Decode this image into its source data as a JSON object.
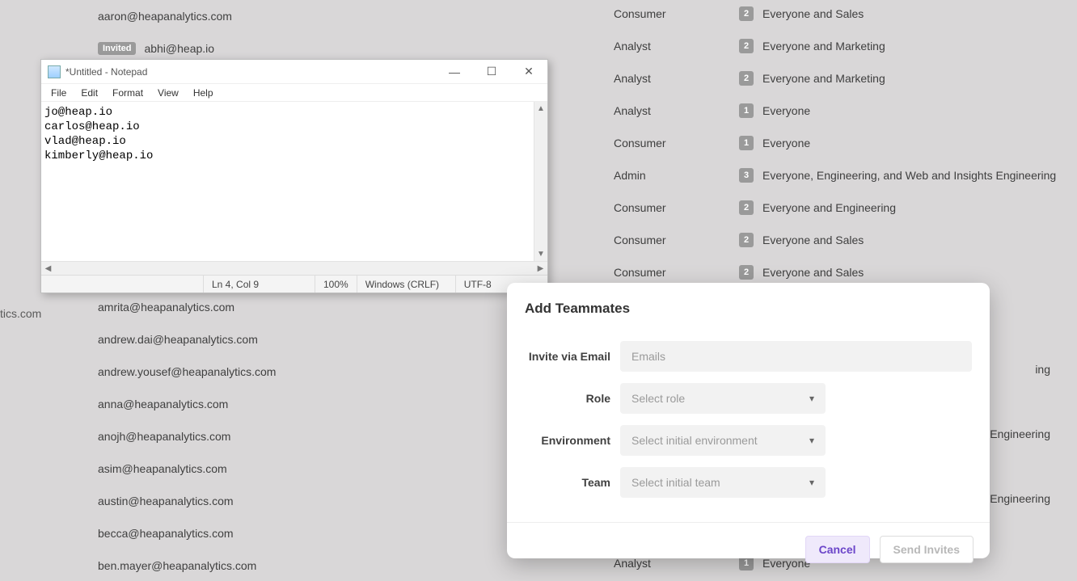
{
  "bg": {
    "left_partial_label": "tics.com",
    "emails": [
      {
        "email": "aaron@heapanalytics.com",
        "invited": false
      },
      {
        "email": "abhi@heap.io",
        "invited": true
      },
      {
        "email": "",
        "invited": false
      },
      {
        "email": "",
        "invited": false
      },
      {
        "email": "",
        "invited": false
      },
      {
        "email": "",
        "invited": false
      },
      {
        "email": "",
        "invited": false
      },
      {
        "email": "",
        "invited": false
      },
      {
        "email": "",
        "invited": false
      },
      {
        "email": "amrita@heapanalytics.com",
        "invited": false
      },
      {
        "email": "andrew.dai@heapanalytics.com",
        "invited": false
      },
      {
        "email": "andrew.yousef@heapanalytics.com",
        "invited": false
      },
      {
        "email": "anna@heapanalytics.com",
        "invited": false
      },
      {
        "email": "anojh@heapanalytics.com",
        "invited": false
      },
      {
        "email": "asim@heapanalytics.com",
        "invited": false
      },
      {
        "email": "austin@heapanalytics.com",
        "invited": false
      },
      {
        "email": "becca@heapanalytics.com",
        "invited": false
      },
      {
        "email": "ben.mayer@heapanalytics.com",
        "invited": false
      }
    ],
    "invited_badge": "Invited",
    "right": [
      {
        "role": "Consumer",
        "count": "2",
        "teams": "Everyone and Sales"
      },
      {
        "role": "Analyst",
        "count": "2",
        "teams": "Everyone and Marketing"
      },
      {
        "role": "Analyst",
        "count": "2",
        "teams": "Everyone and Marketing"
      },
      {
        "role": "Analyst",
        "count": "1",
        "teams": "Everyone"
      },
      {
        "role": "Consumer",
        "count": "1",
        "teams": "Everyone"
      },
      {
        "role": "Admin",
        "count": "3",
        "teams": "Everyone, Engineering, and Web and Insights Engineering"
      },
      {
        "role": "Consumer",
        "count": "2",
        "teams": "Everyone and Engineering"
      },
      {
        "role": "Consumer",
        "count": "2",
        "teams": "Everyone and Sales"
      },
      {
        "role": "Consumer",
        "count": "2",
        "teams": "Everyone and Sales"
      },
      {
        "role": "",
        "count": "",
        "teams": ""
      },
      {
        "role": "",
        "count": "",
        "teams": ""
      },
      {
        "role": "",
        "count": "",
        "teams": "ing"
      },
      {
        "role": "",
        "count": "",
        "teams": ""
      },
      {
        "role": "",
        "count": "",
        "teams": "Engineering"
      },
      {
        "role": "",
        "count": "",
        "teams": ""
      },
      {
        "role": "",
        "count": "",
        "teams": "Engineering"
      },
      {
        "role": "",
        "count": "",
        "teams": ""
      },
      {
        "role": "Analyst",
        "count": "1",
        "teams": "Everyone"
      }
    ]
  },
  "notepad": {
    "title": "*Untitled - Notepad",
    "menus": {
      "file": "File",
      "edit": "Edit",
      "format": "Format",
      "view": "View",
      "help": "Help"
    },
    "content": "jo@heap.io\ncarlos@heap.io\nvlad@heap.io\nkimberly@heap.io",
    "status": {
      "lncol": "Ln 4, Col 9",
      "zoom": "100%",
      "eol": "Windows (CRLF)",
      "enc": "UTF-8"
    }
  },
  "dialog": {
    "title": "Add Teammates",
    "labels": {
      "invite": "Invite via Email",
      "role": "Role",
      "env": "Environment",
      "team": "Team"
    },
    "placeholders": {
      "emails": "Emails",
      "role": "Select role",
      "env": "Select initial environment",
      "team": "Select initial team"
    },
    "buttons": {
      "cancel": "Cancel",
      "send": "Send Invites"
    }
  }
}
